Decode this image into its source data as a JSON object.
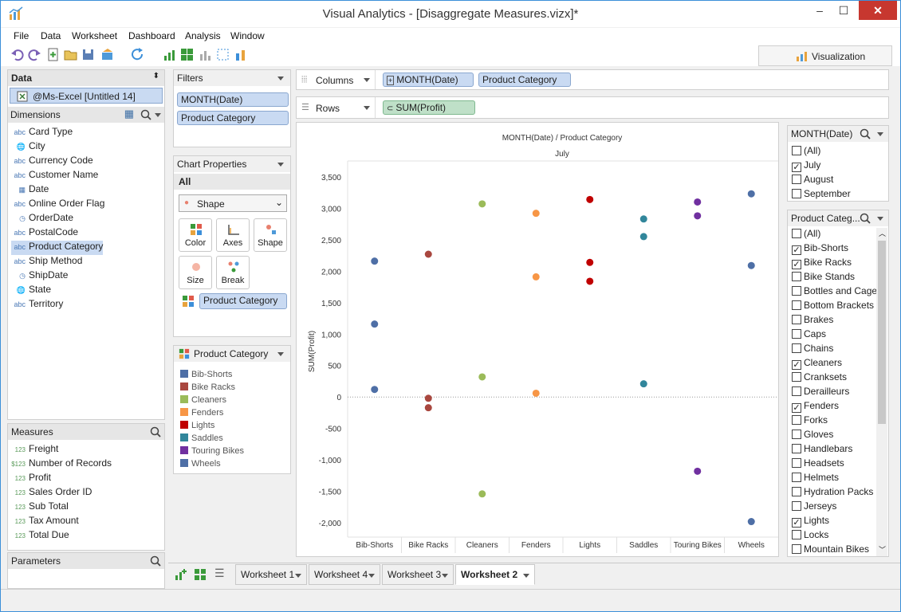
{
  "window": {
    "title": "Visual Analytics - [Disaggregate Measures.vizx]*",
    "min": "–",
    "max": "☐",
    "close": "✕"
  },
  "menu": [
    "File",
    "Data",
    "Worksheet",
    "Dashboard",
    "Analysis",
    "Window"
  ],
  "visualization_tab": "Visualization",
  "data_panel": {
    "header": "Data",
    "source": "@Ms-Excel [Untitled 14]",
    "dimensions_label": "Dimensions",
    "dimensions": [
      {
        "icon": "abc",
        "label": "Card Type"
      },
      {
        "icon": "globe",
        "label": "City"
      },
      {
        "icon": "abc",
        "label": "Currency Code"
      },
      {
        "icon": "abc",
        "label": "Customer Name"
      },
      {
        "icon": "calendar",
        "label": "Date"
      },
      {
        "icon": "abc",
        "label": "Online Order Flag"
      },
      {
        "icon": "datetime",
        "label": "OrderDate"
      },
      {
        "icon": "abc",
        "label": "PostalCode"
      },
      {
        "icon": "abc",
        "label": "Product Category"
      },
      {
        "icon": "abc",
        "label": "Ship Method"
      },
      {
        "icon": "datetime",
        "label": "ShipDate"
      },
      {
        "icon": "globe",
        "label": "State"
      },
      {
        "icon": "abc",
        "label": "Territory"
      }
    ],
    "measures_label": "Measures",
    "measures": [
      {
        "icon": "123",
        "label": "Freight"
      },
      {
        "icon": "$123",
        "label": "Number of Records"
      },
      {
        "icon": "123",
        "label": "Profit"
      },
      {
        "icon": "123",
        "label": "Sales Order ID"
      },
      {
        "icon": "123",
        "label": "Sub Total"
      },
      {
        "icon": "123",
        "label": "Tax Amount"
      },
      {
        "icon": "123",
        "label": "Total Due"
      }
    ],
    "parameters_label": "Parameters"
  },
  "filters": {
    "header": "Filters",
    "items": [
      "MONTH(Date)",
      "Product Category"
    ]
  },
  "chart_properties": {
    "header": "Chart Properties",
    "all": "All",
    "mark_type": "Shape",
    "buttons": [
      "Color",
      "Axes",
      "Shape",
      "Size",
      "Break"
    ],
    "color_field": "Product Category"
  },
  "legend": {
    "header": "Product Category",
    "items": [
      {
        "label": "Bib-Shorts",
        "color": "#4e6fa6"
      },
      {
        "label": "Bike Racks",
        "color": "#a9473f"
      },
      {
        "label": "Cleaners",
        "color": "#9bbb59"
      },
      {
        "label": "Fenders",
        "color": "#f79646"
      },
      {
        "label": "Lights",
        "color": "#c00000"
      },
      {
        "label": "Saddles",
        "color": "#31869b"
      },
      {
        "label": "Touring Bikes",
        "color": "#7030a0"
      },
      {
        "label": "Wheels",
        "color": "#4e6fa6"
      }
    ]
  },
  "shelves": {
    "columns_label": "Columns",
    "columns": [
      "MONTH(Date)",
      "Product Category"
    ],
    "rows_label": "Rows",
    "rows": [
      "SUM(Profit)"
    ]
  },
  "chart_data": {
    "type": "scatter",
    "title": "MONTH(Date) / Product Category",
    "subtitle": "July",
    "ylabel": "SUM(Profit)",
    "ylim": [
      -2100,
      3600
    ],
    "yticks": [
      3500,
      3000,
      2500,
      2000,
      1500,
      1000,
      500,
      0,
      -500,
      -1000,
      -1500,
      -2000
    ],
    "ytick_labels": [
      "3,500",
      "3,000",
      "2,500",
      "2,000",
      "1,500",
      "1,000",
      "500",
      "0",
      "-500",
      "-1,000",
      "-1,500",
      "-2,000"
    ],
    "categories": [
      "Bib-Shorts",
      "Bike Racks",
      "Cleaners",
      "Fenders",
      "Lights",
      "Saddles",
      "Touring Bikes",
      "Wheels"
    ],
    "series": [
      {
        "category": "Bib-Shorts",
        "color": "#4e6fa6",
        "values": [
          2160,
          1160,
          120
        ]
      },
      {
        "category": "Bike Racks",
        "color": "#a9473f",
        "values": [
          2270,
          -20,
          -170
        ]
      },
      {
        "category": "Cleaners",
        "color": "#9bbb59",
        "values": [
          3070,
          320,
          -1540
        ]
      },
      {
        "category": "Fenders",
        "color": "#f79646",
        "values": [
          2920,
          1910,
          60
        ]
      },
      {
        "category": "Lights",
        "color": "#c00000",
        "values": [
          3140,
          2140,
          1840
        ]
      },
      {
        "category": "Saddles",
        "color": "#31869b",
        "values": [
          2830,
          2550,
          210
        ]
      },
      {
        "category": "Touring Bikes",
        "color": "#7030a0",
        "values": [
          3100,
          2880,
          -1180
        ]
      },
      {
        "category": "Wheels",
        "color": "#4e6fa6",
        "values": [
          3230,
          2090,
          -1980
        ]
      }
    ]
  },
  "filter_month": {
    "header": "MONTH(Date)",
    "items": [
      {
        "label": "(All)",
        "checked": false
      },
      {
        "label": "July",
        "checked": true
      },
      {
        "label": "August",
        "checked": false
      },
      {
        "label": "September",
        "checked": false
      }
    ]
  },
  "filter_category": {
    "header": "Product Categ...",
    "items": [
      {
        "label": "(All)",
        "checked": false
      },
      {
        "label": "Bib-Shorts",
        "checked": true
      },
      {
        "label": "Bike Racks",
        "checked": true
      },
      {
        "label": "Bike Stands",
        "checked": false
      },
      {
        "label": "Bottles and Cages",
        "checked": false
      },
      {
        "label": "Bottom Brackets",
        "checked": false
      },
      {
        "label": "Brakes",
        "checked": false
      },
      {
        "label": "Caps",
        "checked": false
      },
      {
        "label": "Chains",
        "checked": false
      },
      {
        "label": "Cleaners",
        "checked": true
      },
      {
        "label": "Cranksets",
        "checked": false
      },
      {
        "label": "Derailleurs",
        "checked": false
      },
      {
        "label": "Fenders",
        "checked": true
      },
      {
        "label": "Forks",
        "checked": false
      },
      {
        "label": "Gloves",
        "checked": false
      },
      {
        "label": "Handlebars",
        "checked": false
      },
      {
        "label": "Headsets",
        "checked": false
      },
      {
        "label": "Helmets",
        "checked": false
      },
      {
        "label": "Hydration Packs",
        "checked": false
      },
      {
        "label": "Jerseys",
        "checked": false
      },
      {
        "label": "Lights",
        "checked": true
      },
      {
        "label": "Locks",
        "checked": false
      },
      {
        "label": "Mountain Bikes",
        "checked": false
      }
    ]
  },
  "sheets": [
    {
      "label": "Worksheet 1",
      "active": false
    },
    {
      "label": "Worksheet 4",
      "active": false
    },
    {
      "label": "Worksheet 3",
      "active": false
    },
    {
      "label": "Worksheet 2",
      "active": true
    }
  ]
}
